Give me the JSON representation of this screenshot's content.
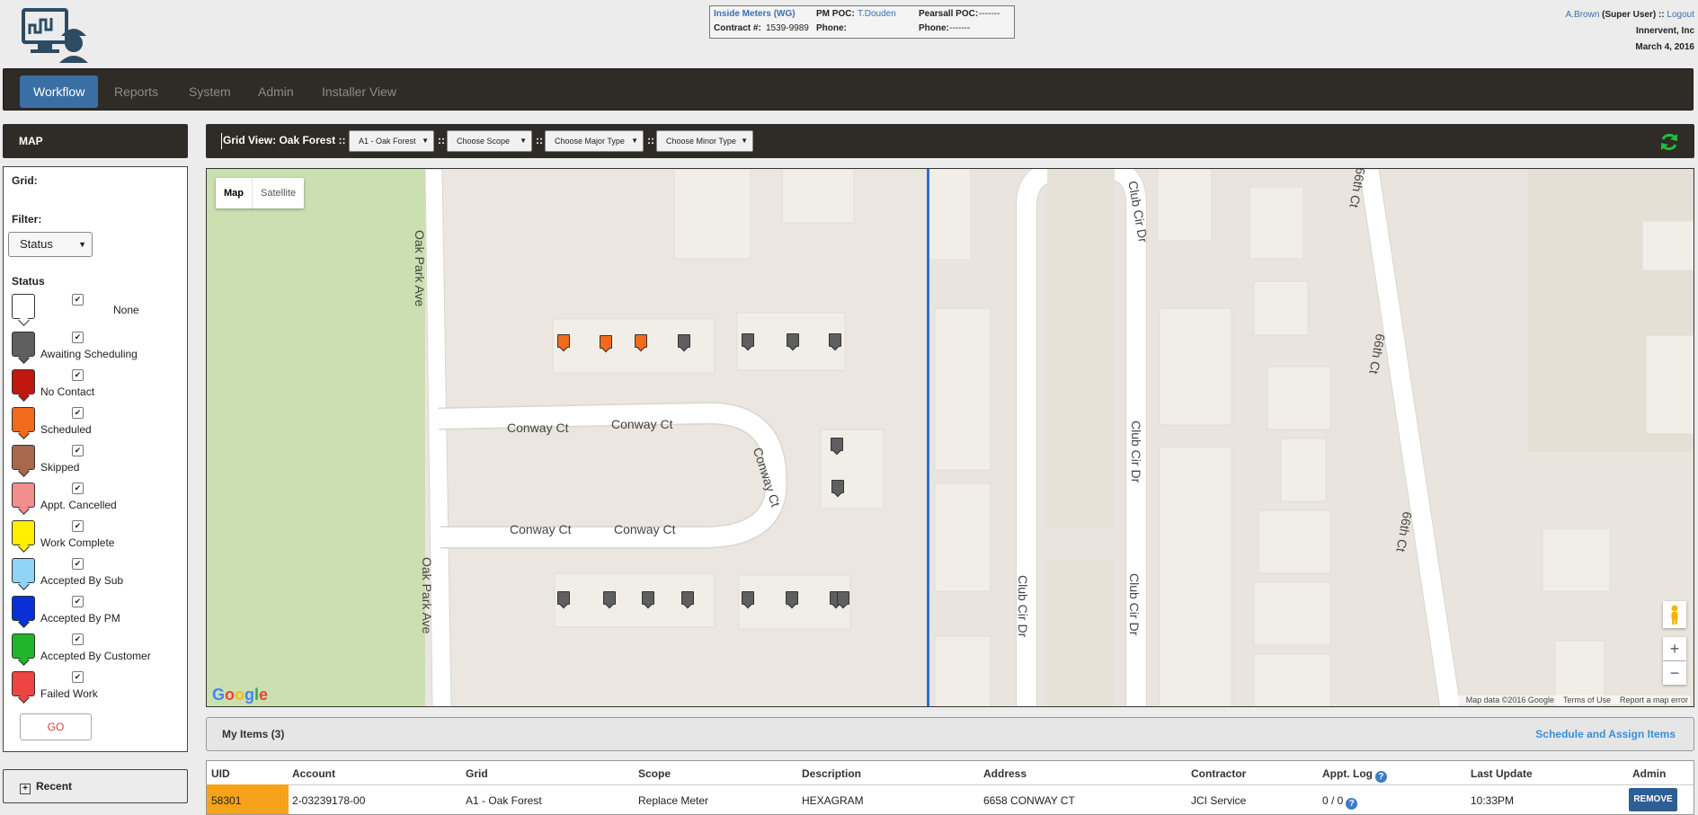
{
  "header": {
    "info": {
      "company_link": "Inside Meters (WG)",
      "contract_label": "Contract #:",
      "contract_value": "1539-9989",
      "pm_poc_label": "PM POC:",
      "pm_poc_value": "T.Douden",
      "phone_label_1": "Phone:",
      "pearsall_poc_label": "Pearsall POC:",
      "pearsall_poc_value": "-------",
      "phone_label_2": "Phone:",
      "phone_value_2": "-------"
    },
    "user": {
      "name": "A.Brown",
      "role": "(Super User) ::",
      "logout": "Logout",
      "company": "Innervent, Inc",
      "date": "March 4, 2016"
    }
  },
  "nav": {
    "items": [
      {
        "label": "Workflow",
        "active": true
      },
      {
        "label": "Reports",
        "active": false
      },
      {
        "label": "System",
        "active": false
      },
      {
        "label": "Admin",
        "active": false
      },
      {
        "label": "Installer View",
        "active": false
      }
    ]
  },
  "left_panel": {
    "title": "MAP",
    "grid_label": "Grid:",
    "filter_label": "Filter:",
    "filter_value": "Status",
    "status_heading": "Status",
    "statuses": [
      {
        "label": "None",
        "color": "#ffffff",
        "checked": true
      },
      {
        "label": "Awaiting Scheduling",
        "color": "#5f5f5f",
        "checked": true
      },
      {
        "label": "No Contact",
        "color": "#c0170f",
        "checked": true
      },
      {
        "label": "Scheduled",
        "color": "#f26a1b",
        "checked": true
      },
      {
        "label": "Skipped",
        "color": "#a8684b",
        "checked": true
      },
      {
        "label": "Appt. Cancelled",
        "color": "#f38e8e",
        "checked": true
      },
      {
        "label": "Work Complete",
        "color": "#ffee00",
        "checked": true
      },
      {
        "label": "Accepted By Sub",
        "color": "#8fd3f6",
        "checked": true
      },
      {
        "label": "Accepted By PM",
        "color": "#0a2fd6",
        "checked": true
      },
      {
        "label": "Accepted By Customer",
        "color": "#1fb52a",
        "checked": true
      },
      {
        "label": "Failed Work",
        "color": "#ef4444",
        "checked": true
      }
    ],
    "go_label": "GO",
    "recent_label": "Recent"
  },
  "toolbar": {
    "grid_view_label": "Grid View: Oak Forest ::",
    "separator": "::",
    "selects": [
      {
        "value": "A1 - Oak Forest"
      },
      {
        "value": "Choose Scope"
      },
      {
        "value": "Choose Major Type"
      },
      {
        "value": "Choose Minor Type"
      }
    ]
  },
  "map": {
    "map_type_map": "Map",
    "map_type_satellite": "Satellite",
    "google_logo": "Google",
    "attribution": [
      "Map data ©2016 Google",
      "Terms of Use",
      "Report a map error"
    ],
    "zoom_in": "+",
    "zoom_out": "−",
    "road_labels": [
      "Oak Park Ave",
      "Oak Park Ave",
      "Conway Ct",
      "Conway Ct",
      "Conway Ct",
      "Conway Ct",
      "Conway Ct",
      "Club Cir Dr",
      "Club Cir Dr",
      "Club Cir Dr",
      "Club Cir Dr",
      "66th Ct",
      "66th Ct",
      "66th Ct"
    ],
    "markers": [
      {
        "status": "Scheduled",
        "color": "#f26a1b"
      },
      {
        "status": "Scheduled",
        "color": "#f26a1b"
      },
      {
        "status": "Scheduled",
        "color": "#f26a1b"
      },
      {
        "status": "Awaiting Scheduling",
        "color": "#5f5f5f"
      },
      {
        "status": "Awaiting Scheduling",
        "color": "#5f5f5f"
      },
      {
        "status": "Awaiting Scheduling",
        "color": "#5f5f5f"
      },
      {
        "status": "Awaiting Scheduling",
        "color": "#5f5f5f"
      },
      {
        "status": "Awaiting Scheduling",
        "color": "#5f5f5f"
      },
      {
        "status": "Awaiting Scheduling",
        "color": "#5f5f5f"
      },
      {
        "status": "Awaiting Scheduling",
        "color": "#5f5f5f"
      },
      {
        "status": "Awaiting Scheduling",
        "color": "#5f5f5f"
      },
      {
        "status": "Awaiting Scheduling",
        "color": "#5f5f5f"
      },
      {
        "status": "Awaiting Scheduling",
        "color": "#5f5f5f"
      },
      {
        "status": "Awaiting Scheduling",
        "color": "#5f5f5f"
      },
      {
        "status": "Awaiting Scheduling",
        "color": "#5f5f5f"
      },
      {
        "status": "Awaiting Scheduling",
        "color": "#5f5f5f"
      },
      {
        "status": "Awaiting Scheduling",
        "color": "#5f5f5f"
      }
    ]
  },
  "items": {
    "title": "My Items (3)",
    "schedule_link": "Schedule and Assign Items",
    "columns": [
      "UID",
      "Account",
      "Grid",
      "Scope",
      "Description",
      "Address",
      "Contractor",
      "Appt. Log",
      "Last Update",
      "Admin"
    ],
    "rows": [
      {
        "uid": "58301",
        "account": "2-03239178-00",
        "grid": "A1 - Oak Forest",
        "scope": "Replace Meter",
        "description": "HEXAGRAM",
        "address": "6658 CONWAY CT",
        "contractor": "JCI Service",
        "appt_log": "0 / 0",
        "last_update": "10:33PM",
        "admin_action": "REMOVE"
      }
    ]
  },
  "colors": {
    "dark_bar": "#2f2b26",
    "nav_active": "#3a6fa5",
    "uid_highlight": "#f7a21b",
    "remove_button": "#2d5f96",
    "map_divider": "#2b6fd6",
    "refresh_icon": "#1fbf3a"
  },
  "icons": {
    "logo": "computer-worker-logo-icon",
    "refresh": "refresh-icon",
    "help": "help-icon",
    "pegman": "pegman-icon",
    "recent_toggle": "plus-icon"
  }
}
